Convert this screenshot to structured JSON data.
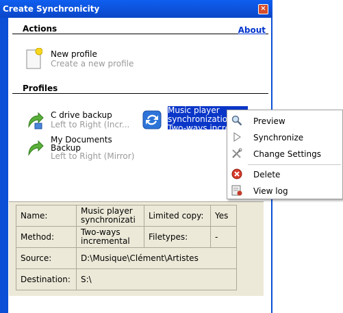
{
  "window": {
    "title": "Create Synchronicity",
    "close_label": "×"
  },
  "actions": {
    "header": "Actions",
    "about": "About",
    "new_profile": {
      "title": "New profile",
      "subtitle": "Create a new profile"
    }
  },
  "profiles": {
    "header": "Profiles",
    "items": [
      {
        "title": "C drive backup",
        "subtitle": "Left to Right (Incr..."
      },
      {
        "title_line1": "My Documents",
        "title_line2": "Backup",
        "subtitle": "Left to Right (Mirror)"
      },
      {
        "line1": "Music player",
        "line2": "synchronizatio",
        "line3": "Two-ways incre"
      }
    ]
  },
  "info": {
    "name_label": "Name:",
    "name_value_1": "Music player",
    "name_value_2": "synchronizati",
    "limited_label": "Limited copy:",
    "limited_value": "Yes",
    "method_label": "Method:",
    "method_value_1": "Two-ways",
    "method_value_2": "incremental",
    "filetypes_label": "Filetypes:",
    "filetypes_value": "-",
    "source_label": "Source:",
    "source_value": "D:\\Musique\\Clément\\Artistes",
    "destination_label": "Destination:",
    "destination_value": "S:\\"
  },
  "context_menu": {
    "items": [
      "Preview",
      "Synchronize",
      "Change Settings",
      "Delete",
      "View log"
    ]
  },
  "colors": {
    "titlebar": "#0a4fd6",
    "selection": "#0a36c8",
    "link": "#0033cc",
    "panel": "#ece9d8"
  }
}
